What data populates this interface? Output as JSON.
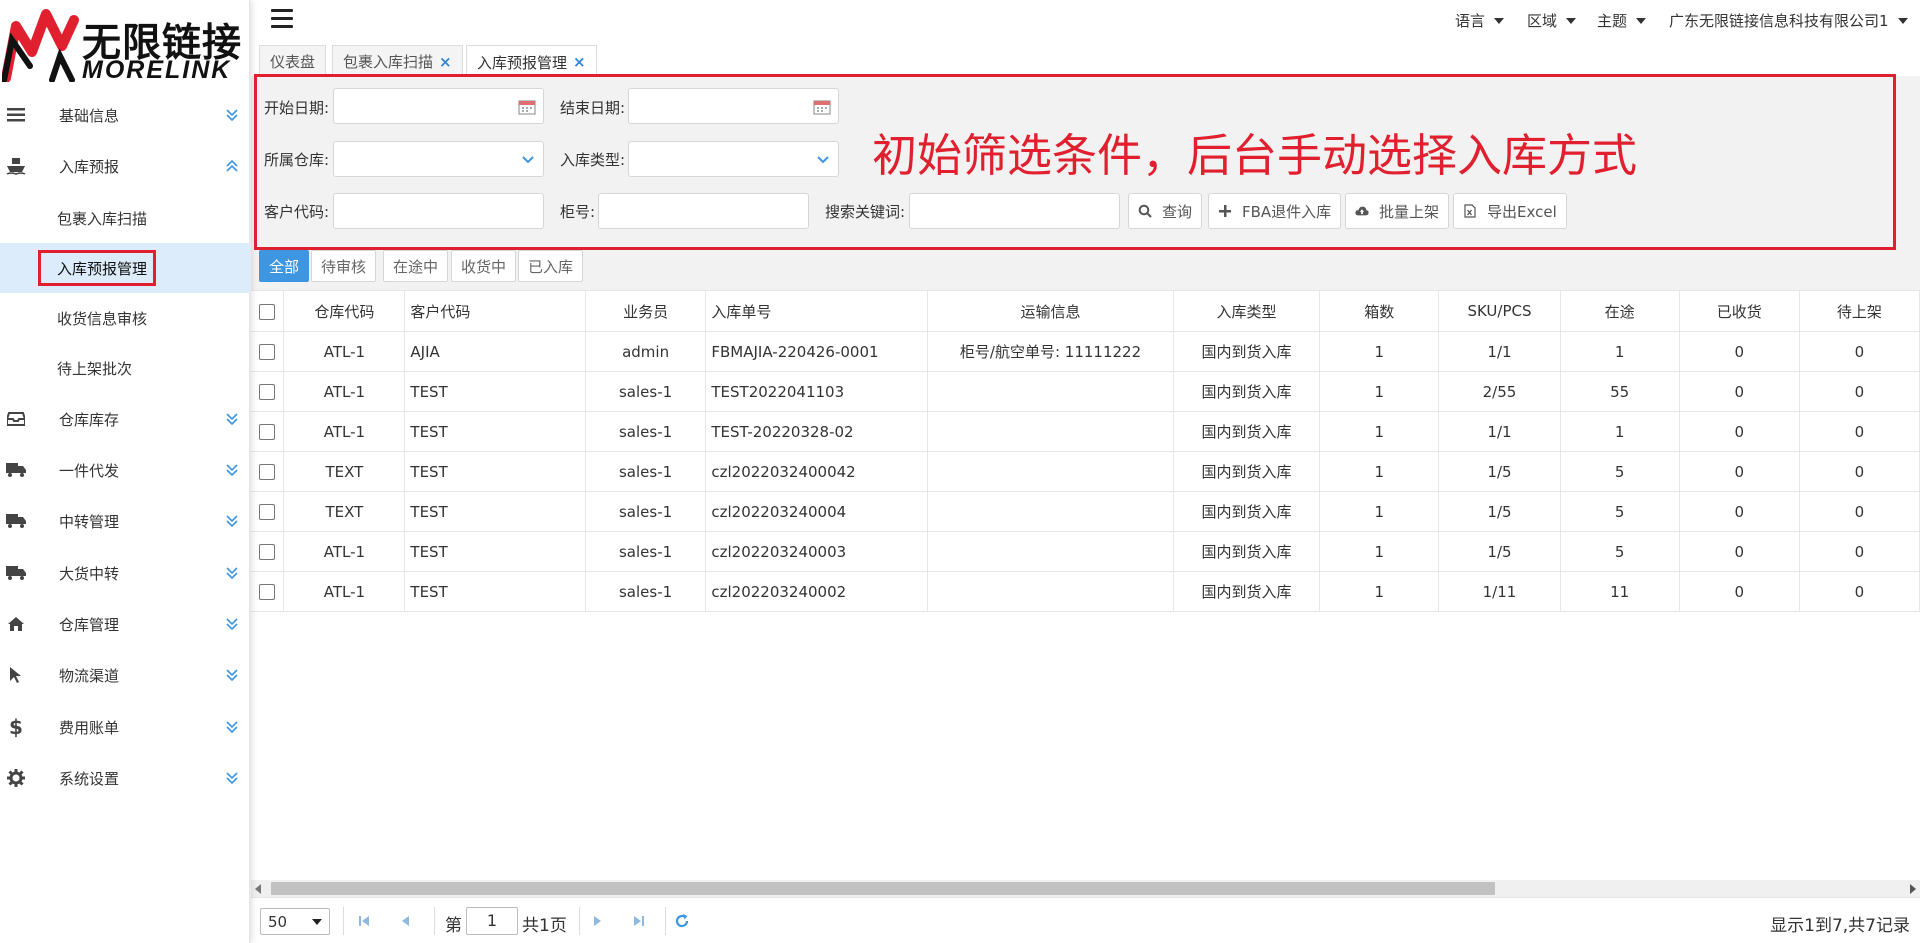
{
  "brand": {
    "cn": "无限链接",
    "en": "MORELINK",
    "color": "#e0202f"
  },
  "sidebar": {
    "items": [
      {
        "label": "基础信息",
        "icon": "list-icon",
        "chevron": "down"
      },
      {
        "label": "入库预报",
        "icon": "ship-icon",
        "chevron": "up"
      },
      {
        "label": "仓库库存",
        "icon": "inbox-icon",
        "chevron": "down"
      },
      {
        "label": "一件代发",
        "icon": "truck-icon",
        "chevron": "down"
      },
      {
        "label": "中转管理",
        "icon": "truck-icon",
        "chevron": "down"
      },
      {
        "label": "大货中转",
        "icon": "truck-icon",
        "chevron": "down"
      },
      {
        "label": "仓库管理",
        "icon": "home-icon",
        "chevron": "down"
      },
      {
        "label": "物流渠道",
        "icon": "cursor-icon",
        "chevron": "down"
      },
      {
        "label": "费用账单",
        "icon": "dollar-icon",
        "chevron": "down"
      },
      {
        "label": "系统设置",
        "icon": "gear-icon",
        "chevron": "down"
      }
    ],
    "subitems": [
      {
        "label": "包裹入库扫描"
      },
      {
        "label": "入库预报管理",
        "active": true
      },
      {
        "label": "收货信息审核"
      },
      {
        "label": "待上架批次"
      }
    ]
  },
  "topbar": {
    "language": "语言",
    "region": "区域",
    "theme": "主题",
    "company": "广东无限链接信息科技有限公司1"
  },
  "tabs": [
    {
      "label": "仪表盘",
      "closable": false
    },
    {
      "label": "包裹入库扫描",
      "closable": true,
      "close": "×"
    },
    {
      "label": "入库预报管理",
      "closable": true,
      "close": "×",
      "active": true
    }
  ],
  "filter": {
    "start_date_label": "开始日期:",
    "end_date_label": "结束日期:",
    "warehouse_label": "所属仓库:",
    "type_label": "入库类型:",
    "customer_label": "客户代码:",
    "container_label": "柜号:",
    "keyword_label": "搜索关键词:",
    "start_date_value": "",
    "end_date_value": "",
    "warehouse_value": "",
    "type_value": "",
    "customer_value": "",
    "container_value": "",
    "keyword_value": "",
    "buttons": {
      "search": "查询",
      "fba_return": "FBA退件入库",
      "batch_shelve": "批量上架",
      "export": "导出Excel"
    }
  },
  "annotation": "初始筛选条件，后台手动选择入库方式",
  "status_tabs": [
    {
      "label": "全部",
      "active": true
    },
    {
      "label": "待审核"
    },
    {
      "label": "在途中"
    },
    {
      "label": "收货中"
    },
    {
      "label": "已入库"
    }
  ],
  "table": {
    "columns": [
      "仓库代码",
      "客户代码",
      "业务员",
      "入库单号",
      "运输信息",
      "入库类型",
      "箱数",
      "SKU/PCS",
      "在途",
      "已收货",
      "待上架"
    ],
    "rows": [
      [
        "ATL-1",
        "AJIA",
        "admin",
        "FBMAJIA-220426-0001",
        "柜号/航空单号: 11111222",
        "国内到货入库",
        "1",
        "1/1",
        "1",
        "0",
        "0"
      ],
      [
        "ATL-1",
        "TEST",
        "sales-1",
        "TEST2022041103",
        "",
        "国内到货入库",
        "1",
        "2/55",
        "55",
        "0",
        "0"
      ],
      [
        "ATL-1",
        "TEST",
        "sales-1",
        "TEST-20220328-02",
        "",
        "国内到货入库",
        "1",
        "1/1",
        "1",
        "0",
        "0"
      ],
      [
        "TEXT",
        "TEST",
        "sales-1",
        "czl2022032400042",
        "",
        "国内到货入库",
        "1",
        "1/5",
        "5",
        "0",
        "0"
      ],
      [
        "TEXT",
        "TEST",
        "sales-1",
        "czl202203240004",
        "",
        "国内到货入库",
        "1",
        "1/5",
        "5",
        "0",
        "0"
      ],
      [
        "ATL-1",
        "TEST",
        "sales-1",
        "czl202203240003",
        "",
        "国内到货入库",
        "1",
        "1/5",
        "5",
        "0",
        "0"
      ],
      [
        "ATL-1",
        "TEST",
        "sales-1",
        "czl202203240002",
        "",
        "国内到货入库",
        "1",
        "1/11",
        "11",
        "0",
        "0"
      ]
    ]
  },
  "pager": {
    "page_size": "50",
    "page_prefix": "第",
    "page_value": "1",
    "page_suffix": "共1页",
    "info": "显示1到7,共7记录"
  },
  "colors": {
    "accent": "#3e95e0",
    "highlight": "#e0202f",
    "active_row": "#dcecfa"
  }
}
